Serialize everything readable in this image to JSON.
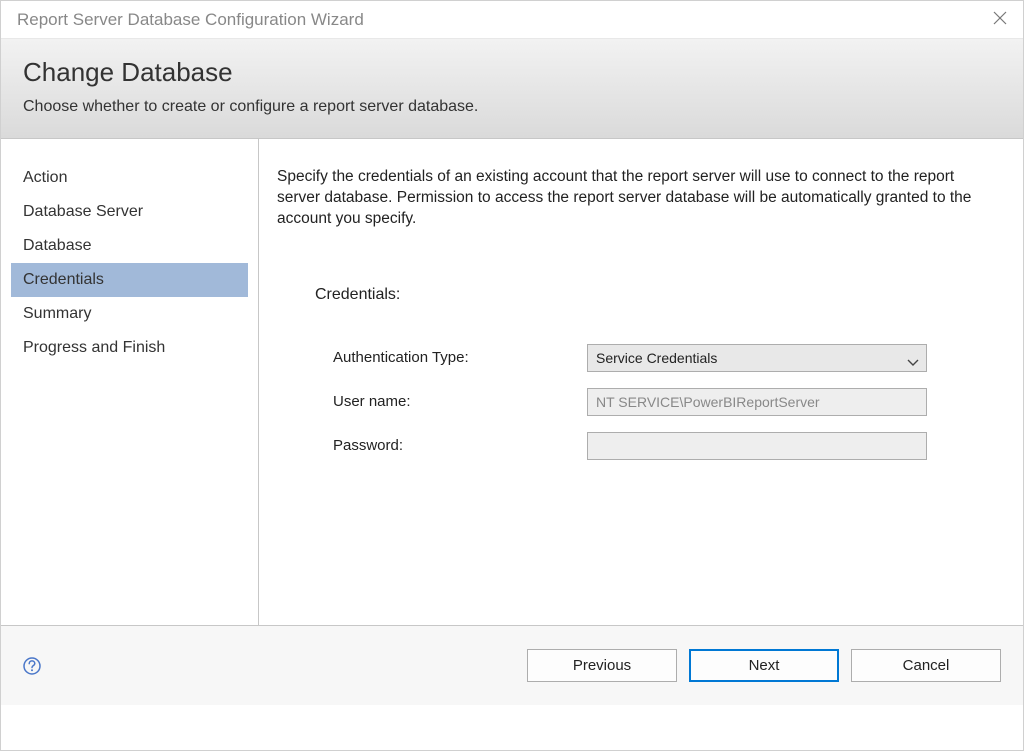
{
  "titlebar": {
    "title": "Report Server Database Configuration Wizard"
  },
  "header": {
    "title": "Change Database",
    "subtitle": "Choose whether to create or configure a report server database."
  },
  "sidebar": {
    "items": [
      {
        "label": "Action"
      },
      {
        "label": "Database Server"
      },
      {
        "label": "Database"
      },
      {
        "label": "Credentials"
      },
      {
        "label": "Summary"
      },
      {
        "label": "Progress and Finish"
      }
    ],
    "activeIndex": 3
  },
  "content": {
    "description": "Specify the credentials of an existing account that the report server will use to connect to the report server database.  Permission to access the report server database will be automatically granted to the account you specify.",
    "section_label": "Credentials:",
    "form": {
      "auth_type_label": "Authentication Type:",
      "auth_type_value": "Service Credentials",
      "username_label": "User name:",
      "username_value": "NT SERVICE\\PowerBIReportServer",
      "password_label": "Password:",
      "password_value": ""
    }
  },
  "footer": {
    "previous": "Previous",
    "next": "Next",
    "cancel": "Cancel"
  }
}
